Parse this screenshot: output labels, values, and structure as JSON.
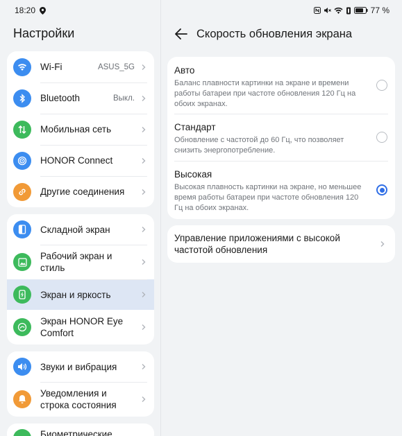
{
  "status": {
    "time": "18:20",
    "battery": "77 %",
    "location_icon": "location-icon",
    "nfc_icon": "nfc-icon",
    "mute_icon": "mute-icon",
    "wifi_icon": "wifi-icon",
    "battery_icon": "battery-icon"
  },
  "sidebar": {
    "title": "Настройки",
    "groups": [
      [
        {
          "label": "Wi-Fi",
          "value": "ASUS_5G",
          "icon": "wifi-icon",
          "color": "#3c8df0"
        },
        {
          "label": "Bluetooth",
          "value": "Выкл.",
          "icon": "bluetooth-icon",
          "color": "#3c8df0"
        },
        {
          "label": "Мобильная сеть",
          "value": "",
          "icon": "mobile-data-icon",
          "color": "#3dba5c"
        },
        {
          "label": "HONOR Connect",
          "value": "",
          "icon": "honor-connect-icon",
          "color": "#3c8df0"
        },
        {
          "label": "Другие соединения",
          "value": "",
          "icon": "link-icon",
          "color": "#f19a37"
        }
      ],
      [
        {
          "label": "Складной экран",
          "value": "",
          "icon": "fold-screen-icon",
          "color": "#3c8df0"
        },
        {
          "label": "Рабочий экран и стиль",
          "value": "",
          "icon": "wallpaper-icon",
          "color": "#3dba5c"
        },
        {
          "label": "Экран и яркость",
          "value": "",
          "icon": "display-icon",
          "color": "#3dba5c"
        },
        {
          "label": "Экран HONOR Eye Comfort",
          "value": "",
          "icon": "eye-comfort-icon",
          "color": "#3dba5c"
        }
      ],
      [
        {
          "label": "Звуки и вибрация",
          "value": "",
          "icon": "sound-icon",
          "color": "#3c8df0"
        },
        {
          "label": "Уведомления и строка состояния",
          "value": "",
          "icon": "notification-icon",
          "color": "#f19a37"
        }
      ],
      [
        {
          "label": "Биометрические",
          "value": "",
          "icon": "biometrics-icon",
          "color": "#3dba5c"
        }
      ]
    ]
  },
  "detail": {
    "back_icon": "back-arrow-icon",
    "title": "Скорость обновления экрана",
    "options": [
      {
        "title": "Авто",
        "desc": "Баланс плавности картинки на экране и времени работы батареи при частоте обновления 120 Гц на обоих экранах.",
        "selected": false
      },
      {
        "title": "Стандарт",
        "desc": "Обновление с частотой до 60 Гц, что позволяет снизить энергопотребление.",
        "selected": false
      },
      {
        "title": "Высокая",
        "desc": "Высокая плавность картинки на экране, но меньшее время работы батареи при частоте обновления 120 Гц на обоих экранах.",
        "selected": true
      }
    ],
    "app_management": "Управление приложениями с высокой частотой обновления"
  }
}
